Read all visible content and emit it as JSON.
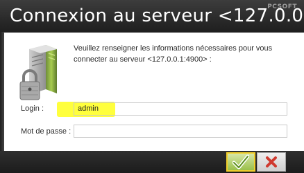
{
  "window": {
    "title": "Connexion au serveur <127.0.0....",
    "brand": "PCSOFT"
  },
  "message": "Veuillez renseigner les informations nécessaires pour vous connecter au serveur <127.0.0.1:4900> :",
  "form": {
    "login_label": "Login :",
    "login_value": "admin",
    "password_label": "Mot de passe :",
    "password_value": ""
  },
  "buttons": {
    "ok_icon": "check-icon",
    "cancel_icon": "close-icon"
  },
  "colors": {
    "title_bar": "#2a2a2a",
    "highlight": "#ffff33",
    "ok_border": "#f2ce2a",
    "cancel_x": "#d03a2f"
  }
}
